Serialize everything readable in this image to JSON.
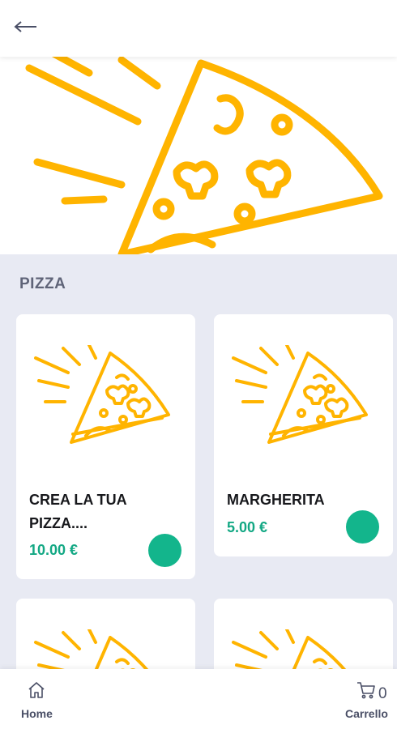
{
  "colors": {
    "accent": "#13b58c",
    "price": "#13a884",
    "pizza_illustration": "#ffb400",
    "background": "#e8eaf3"
  },
  "header": {
    "back_icon": "arrow-left-icon"
  },
  "section": {
    "title": "PIZZA"
  },
  "products": [
    {
      "name": "CREA LA TUA PIZZA....",
      "price": "10.00 €"
    },
    {
      "name": "MARGHERITA",
      "price": "5.00 €"
    }
  ],
  "bottom_nav": {
    "home_label": "Home",
    "cart_label": "Carrello",
    "cart_count": "0"
  }
}
